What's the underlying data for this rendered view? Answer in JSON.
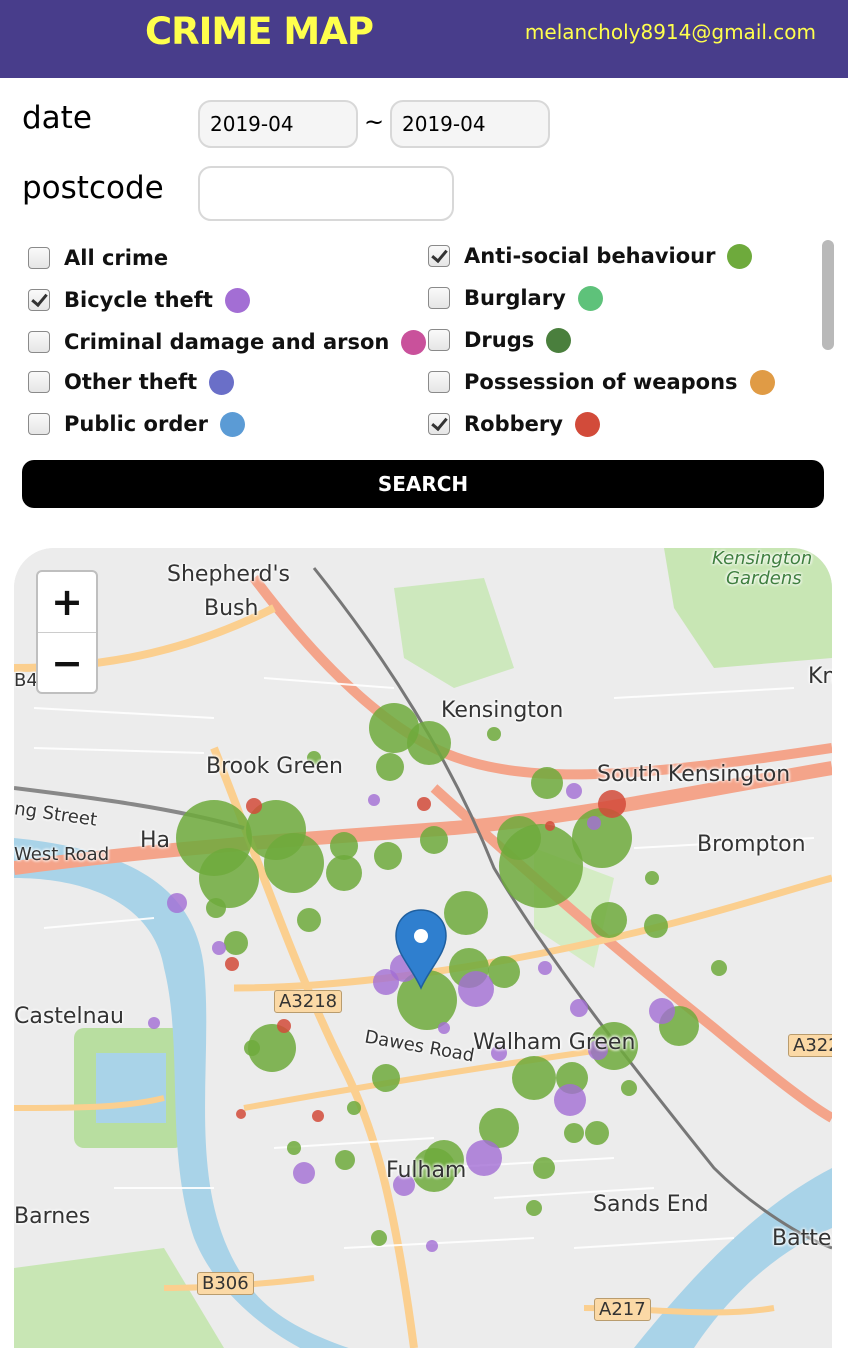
{
  "header": {
    "title": "CRIME MAP",
    "email": "melancholy8914@gmail.com"
  },
  "form": {
    "date_label": "date",
    "date_from": "2019-04",
    "separator": "~",
    "date_to": "2019-04",
    "postcode_label": "postcode",
    "postcode_value": ""
  },
  "filters": [
    {
      "label": "All crime",
      "checked": false,
      "color": ""
    },
    {
      "label": "Anti-social behaviour",
      "checked": true,
      "color": "#6eaa3c"
    },
    {
      "label": "Bicycle theft",
      "checked": true,
      "color": "#a36ed4"
    },
    {
      "label": "Burglary",
      "checked": false,
      "color": "#5ec27a"
    },
    {
      "label": "Criminal damage and arson",
      "checked": false,
      "color": "#c9519b"
    },
    {
      "label": "Drugs",
      "checked": false,
      "color": "#4a7f3d"
    },
    {
      "label": "Other theft",
      "checked": false,
      "color": "#6a6fc8"
    },
    {
      "label": "Possession of weapons",
      "checked": false,
      "color": "#e09b45"
    },
    {
      "label": "Public order",
      "checked": false,
      "color": "#5b9bd5"
    },
    {
      "label": "Robbery",
      "checked": true,
      "color": "#d24b3a"
    }
  ],
  "search_label": "SEARCH",
  "map": {
    "zoom_in": "+",
    "zoom_out": "−",
    "places": [
      {
        "name": "Shepherd's"
      },
      {
        "name": "Bush"
      },
      {
        "name": "Kensington"
      },
      {
        "name": "Gardens"
      },
      {
        "name": "Kensington"
      },
      {
        "name": "Brook Green"
      },
      {
        "name": "South Kensington"
      },
      {
        "name": "Brompton"
      },
      {
        "name": "Castelnau"
      },
      {
        "name": "Walham Green"
      },
      {
        "name": "Fulham"
      },
      {
        "name": "Sands End"
      },
      {
        "name": "Barnes"
      },
      {
        "name": "Batte"
      },
      {
        "name": "Kn"
      },
      {
        "name": "B4"
      },
      {
        "name": "Ha"
      },
      {
        "name": "ng Street"
      },
      {
        "name": "West Road"
      },
      {
        "name": "Dawes Road"
      }
    ],
    "roads": [
      "A3218",
      "A322",
      "B306",
      "A217"
    ],
    "marker_color": "#2f7fcf"
  }
}
